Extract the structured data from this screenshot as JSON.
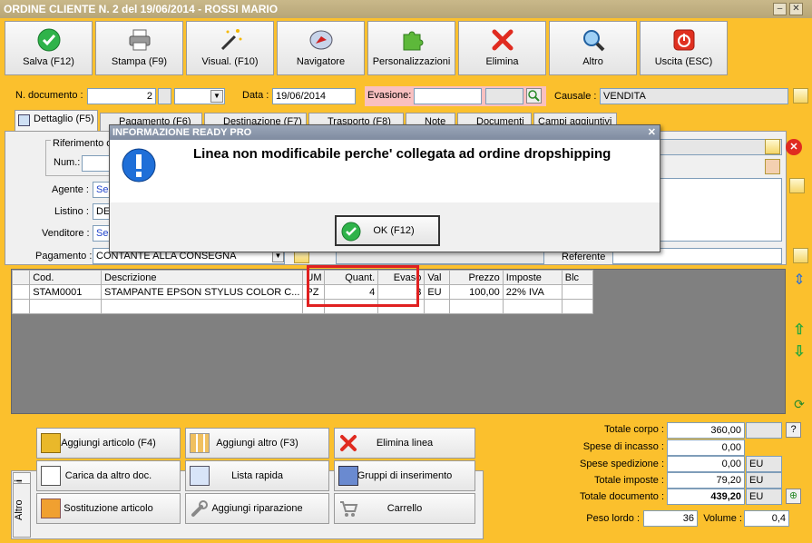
{
  "window": {
    "title": "ORDINE CLIENTE N. 2 del 19/06/2014 - ROSSI MARIO"
  },
  "toolbar": [
    {
      "label": "Salva (F12)",
      "icon": "check-icon"
    },
    {
      "label": "Stampa (F9)",
      "icon": "printer-icon"
    },
    {
      "label": "Visual. (F10)",
      "icon": "magic-wand-icon"
    },
    {
      "label": "Navigatore",
      "icon": "compass-icon"
    },
    {
      "label": "Personalizzazioni",
      "icon": "puzzle-icon"
    },
    {
      "label": "Elimina",
      "icon": "delete-icon"
    },
    {
      "label": "Altro",
      "icon": "magnifier-icon"
    },
    {
      "label": "Uscita (ESC)",
      "icon": "power-icon"
    }
  ],
  "header": {
    "ndoc_label": "N. documento :",
    "ndoc_value": "2",
    "data_label": "Data :",
    "data_value": "19/06/2014",
    "evasione_label": "Evasione:",
    "causale_label": "Causale :",
    "causale_value": "VENDITA"
  },
  "tabs": [
    {
      "label": "Dettaglio (F5)"
    },
    {
      "label": "Pagamento (F6)"
    },
    {
      "label": "Destinazione (F7)"
    },
    {
      "label": "Trasporto (F8)"
    },
    {
      "label": "Note"
    },
    {
      "label": "Documenti"
    },
    {
      "label": "Campi aggiuntivi"
    }
  ],
  "dettaglio": {
    "riferimento_label": "Riferimento o",
    "num_label": "Num.:",
    "agente_label": "Agente :",
    "agente_value": "Sel",
    "listino_label": "Listino :",
    "listino_value": "DE",
    "venditore_label": "Venditore :",
    "venditore_value": "Sel",
    "pagamento_label": "Pagamento :",
    "pagamento_value": "CONTANTE ALLA CONSEGNA",
    "referente_label": "Referente"
  },
  "grid": {
    "columns": [
      "Cod.",
      "Descrizione",
      "UM",
      "Quant.",
      "Evaso",
      "Val",
      "Prezzo",
      "Imposte",
      "Blc"
    ],
    "rows": [
      [
        "STAM0001",
        "STAMPANTE EPSON STYLUS COLOR C...",
        "PZ",
        "4",
        "3",
        "EU",
        "100,00",
        "22% IVA",
        ""
      ]
    ]
  },
  "side_tabs": {
    "azioni": "Azioni",
    "altro": "Altro"
  },
  "actions": [
    {
      "label": "Aggiungi articolo (F4)",
      "icon": "add-box-icon"
    },
    {
      "label": "Aggiungi altro (F3)",
      "icon": "add-grid-icon"
    },
    {
      "label": "Elimina linea",
      "icon": "delete-icon"
    },
    {
      "label": "Carica da altro doc.",
      "icon": "load-doc-icon"
    },
    {
      "label": "Lista rapida",
      "icon": "quick-list-icon"
    },
    {
      "label": "Gruppi di inserimento",
      "icon": "group-add-icon"
    },
    {
      "label": "Sostituzione articolo",
      "icon": "swap-icon"
    },
    {
      "label": "Aggiungi riparazione",
      "icon": "wrench-icon"
    },
    {
      "label": "Carrello",
      "icon": "cart-icon"
    }
  ],
  "totals": {
    "totale_corpo_label": "Totale corpo :",
    "totale_corpo": "360,00",
    "spese_incasso_label": "Spese di incasso :",
    "spese_incasso": "0,00",
    "spese_spedizione_label": "Spese spedizione :",
    "spese_spedizione": "0,00",
    "spese_spedizione_val": "EU",
    "totale_imposte_label": "Totale imposte :",
    "totale_imposte": "79,20",
    "totale_imposte_val": "EU",
    "totale_documento_label": "Totale documento :",
    "totale_documento": "439,20",
    "totale_documento_val": "EU",
    "peso_label": "Peso lordo :",
    "peso": "36",
    "volume_label": "Volume :",
    "volume": "0,4",
    "help": "?"
  },
  "dialog": {
    "title": "INFORMAZIONE READY PRO",
    "close": "✕",
    "message": "Linea non modificabile perche' collegata ad ordine dropshipping",
    "ok_label": "OK (F12)"
  },
  "colors": {
    "background": "#fbc02d",
    "highlight": "#e02020",
    "evasione_bg": "#f9c0c0"
  }
}
